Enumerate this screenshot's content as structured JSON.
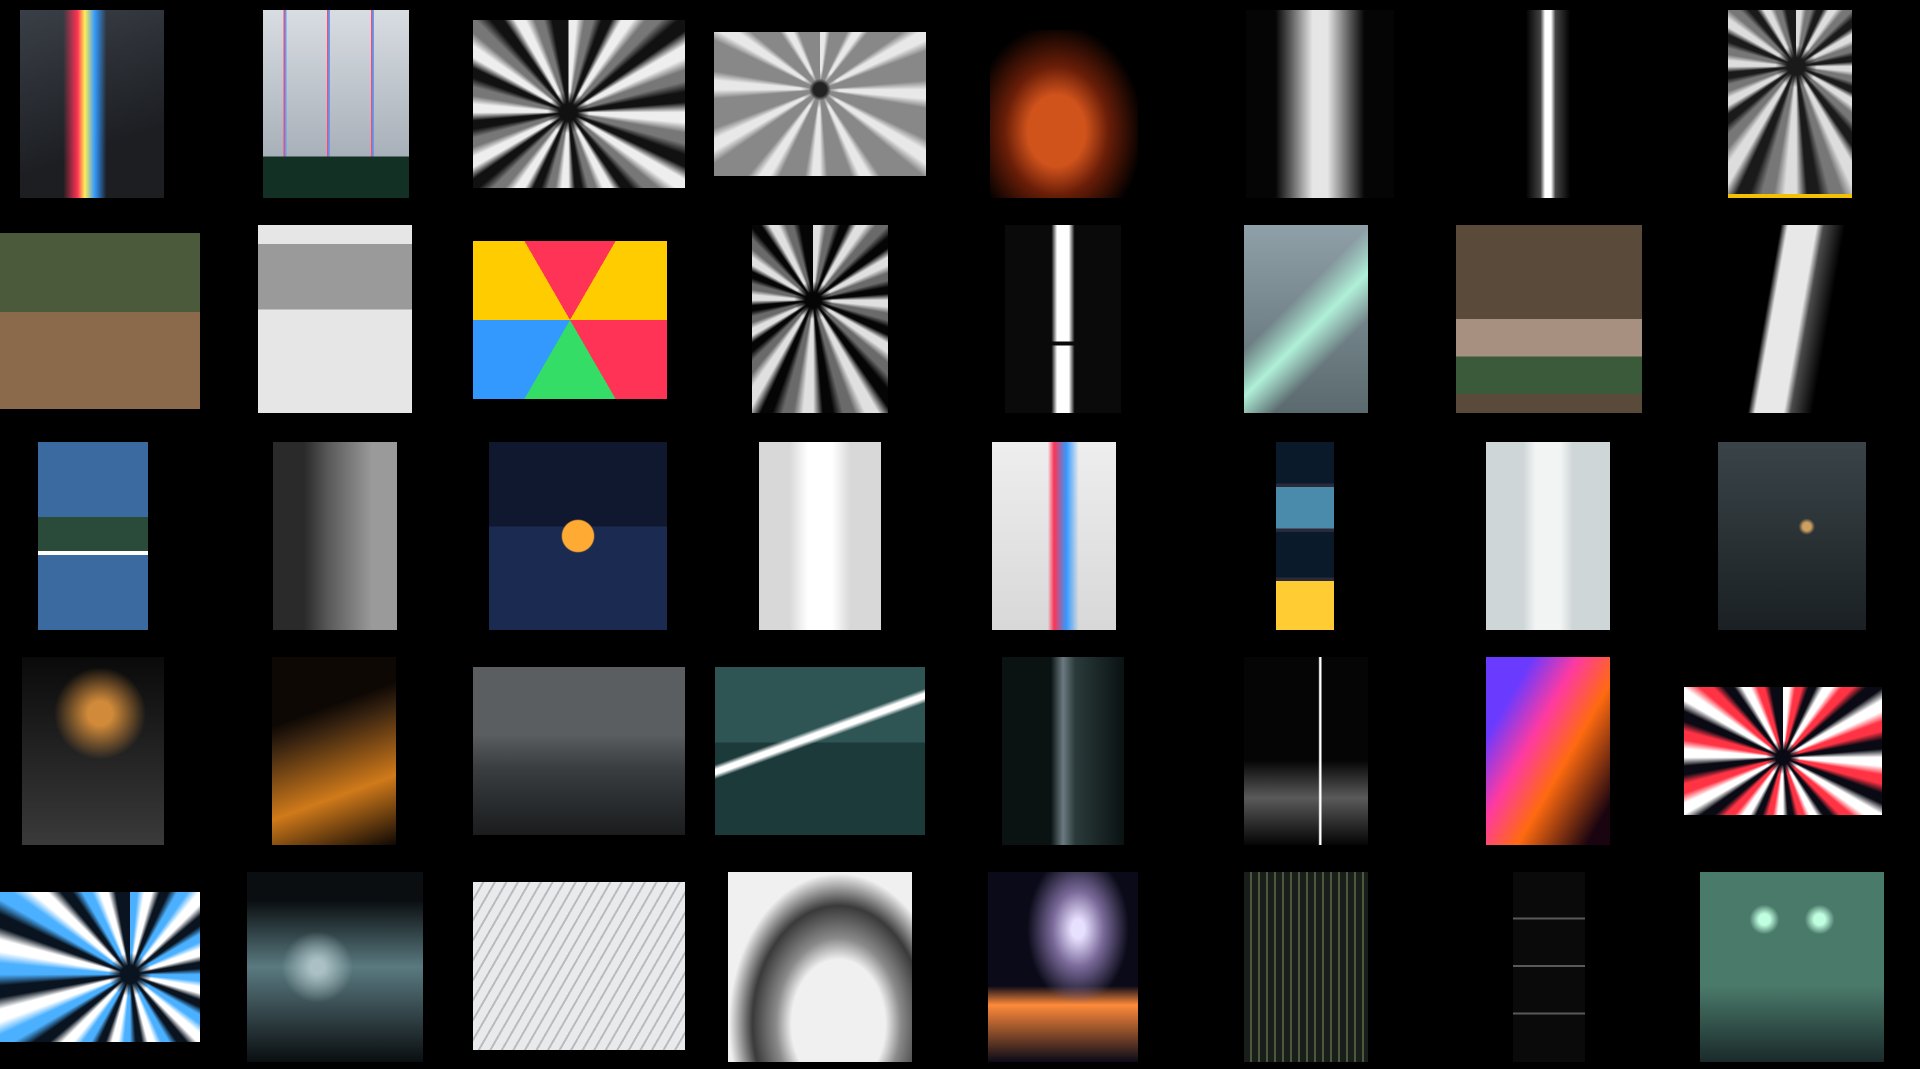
{
  "board": {
    "background": "#000000",
    "rows": [
      {
        "row": 1,
        "tiles": [
          {
            "id": "r1c1",
            "style": "prism-wall",
            "colors": [
              "#1c1e22",
              "#3a3f47",
              "#ff3355",
              "#3399ff",
              "#ffee55"
            ]
          },
          {
            "id": "r1c2",
            "style": "rainbow-room",
            "colors": [
              "#d8dde2",
              "#9aa3ad",
              "#ff4477",
              "#44aaff",
              "#123024"
            ]
          },
          {
            "id": "r1c3",
            "style": "speed-tunnel",
            "colors": [
              "#111111",
              "#eeeeee",
              "#777777",
              "#ff3300",
              "#ffcc00"
            ]
          },
          {
            "id": "r1c4",
            "style": "zoom-corridor",
            "colors": [
              "#222222",
              "#e8e8e8",
              "#888888"
            ]
          },
          {
            "id": "r1c5",
            "style": "orange-glow",
            "colors": [
              "#000000",
              "#d0531c",
              "#6a1e08",
              "#ffffff"
            ]
          },
          {
            "id": "r1c6",
            "style": "light-slit",
            "colors": [
              "#050505",
              "#e6e6e6",
              "#5a5a5a"
            ]
          },
          {
            "id": "r1c7",
            "style": "light-slit-dark",
            "colors": [
              "#000000",
              "#ffffff",
              "#444444"
            ]
          },
          {
            "id": "r1c8",
            "style": "tunnel-yellow",
            "colors": [
              "#1a1a1a",
              "#dddddd",
              "#f2c200"
            ]
          }
        ]
      },
      {
        "row": 2,
        "tiles": [
          {
            "id": "r2c1",
            "style": "inverted-bedroom",
            "colors": [
              "#4a5a3a",
              "#8a6a4a",
              "#2a5a9a",
              "#c45a2a"
            ]
          },
          {
            "id": "r2c2",
            "style": "gallery-window",
            "colors": [
              "#e6e6e6",
              "#9a9a9a",
              "#3a3a3a"
            ]
          },
          {
            "id": "r2c3",
            "style": "hex-cube",
            "colors": [
              "#2a0800",
              "#ffcc00",
              "#ff3355",
              "#33dd66",
              "#3399ff"
            ]
          },
          {
            "id": "r2c4",
            "style": "bw-spiral",
            "colors": [
              "#050505",
              "#e0e0e0",
              "#6a6a6a"
            ]
          },
          {
            "id": "r2c5",
            "style": "split-prism",
            "colors": [
              "#0a0a0a",
              "#ffffff",
              "#888888"
            ]
          },
          {
            "id": "r2c6",
            "style": "fog-building",
            "colors": [
              "#8fa0a8",
              "#5a6a6e",
              "#b0f0d8"
            ]
          },
          {
            "id": "r2c7",
            "style": "inverted-living",
            "colors": [
              "#5a4a3a",
              "#a89080",
              "#3a5a3a",
              "#ffffff"
            ]
          },
          {
            "id": "r2c8",
            "style": "skyscraper-void",
            "colors": [
              "#000000",
              "#e8e8e8",
              "#4a4a4a"
            ]
          }
        ]
      },
      {
        "row": 3,
        "tiles": [
          {
            "id": "r3c1",
            "style": "triple-motion",
            "colors": [
              "#3a6aa0",
              "#d8b060",
              "#2a4a3a",
              "#ffffff"
            ]
          },
          {
            "id": "r3c2",
            "style": "fog-cliff",
            "colors": [
              "#2a2a2a",
              "#9a9a9a",
              "#5a5a5a"
            ]
          },
          {
            "id": "r3c3",
            "style": "harbour-sunset",
            "colors": [
              "#101830",
              "#ffaa33",
              "#ff3322",
              "#1a2a50"
            ]
          },
          {
            "id": "r3c4",
            "style": "rainbow-beam",
            "colors": [
              "#d8d8d8",
              "#ffffff",
              "#ff3355",
              "#33dd66",
              "#3399ff"
            ]
          },
          {
            "id": "r3c5",
            "style": "shadow-spectrum",
            "colors": [
              "#eeeeee",
              "#d8d8d8",
              "#ff3355",
              "#3399ff",
              "#2a1a20"
            ]
          },
          {
            "id": "r3c6",
            "style": "four-panel-night",
            "colors": [
              "#0a1a2a",
              "#4a8aaa",
              "#ffcc33",
              "#2a2a3a"
            ]
          },
          {
            "id": "r3c7",
            "style": "pale-beam",
            "colors": [
              "#cfd6d8",
              "#f2f4f4",
              "#8aa0a8"
            ]
          },
          {
            "id": "r3c8",
            "style": "fog-house",
            "colors": [
              "#1a2024",
              "#3a4448",
              "#d0a060"
            ]
          }
        ]
      },
      {
        "row": 4,
        "tiles": [
          {
            "id": "r4c1",
            "style": "rainy-street",
            "colors": [
              "#0a0a0a",
              "#d08a3a",
              "#3a3a3a"
            ]
          },
          {
            "id": "r4c2",
            "style": "overpass-amber",
            "colors": [
              "#0e0804",
              "#d07a1a",
              "#3a2410"
            ]
          },
          {
            "id": "r4c3",
            "style": "misty-plain",
            "colors": [
              "#3a3e40",
              "#1a1c1e",
              "#5a5e60"
            ]
          },
          {
            "id": "r4c4",
            "style": "teal-room",
            "colors": [
              "#1c3a3a",
              "#2e5454",
              "#ffffff",
              "#c8d8c8"
            ]
          },
          {
            "id": "r4c5",
            "style": "tower-mist",
            "colors": [
              "#0a1212",
              "#2a3a3a",
              "#6a7a80"
            ]
          },
          {
            "id": "r4c6",
            "style": "floor-rays",
            "colors": [
              "#050505",
              "#ffffff",
              "#5a5a5a"
            ]
          },
          {
            "id": "r4c7",
            "style": "neon-bridge",
            "colors": [
              "#1a0410",
              "#ff6a10",
              "#ff3aa0",
              "#6a3aff"
            ]
          },
          {
            "id": "r4c8",
            "style": "color-speed",
            "colors": [
              "#0a0a14",
              "#ffffff",
              "#ff3344",
              "#3399ff"
            ]
          }
        ]
      },
      {
        "row": 5,
        "tiles": [
          {
            "id": "r5c1",
            "style": "blue-warp",
            "colors": [
              "#0a1420",
              "#4ab0ff",
              "#ffffff",
              "#ff9944"
            ]
          },
          {
            "id": "r5c2",
            "style": "night-underpass",
            "colors": [
              "#0a0e10",
              "#5a7a80",
              "#aac0c4"
            ]
          },
          {
            "id": "r5c3",
            "style": "snow-rays",
            "colors": [
              "#e8eaec",
              "#b8bcc0",
              "#202020"
            ]
          },
          {
            "id": "r5c4",
            "style": "white-curve",
            "colors": [
              "#f0f0f0",
              "#3a3a3a",
              "#8a8a8a"
            ]
          },
          {
            "id": "r5c5",
            "style": "galaxy-bridge",
            "colors": [
              "#0a0a18",
              "#7a6a9a",
              "#ff8a3a",
              "#e8e0ff"
            ]
          },
          {
            "id": "r5c6",
            "style": "forest-glow",
            "colors": [
              "#1a1e1a",
              "#4a5a3a",
              "#c0d8a0"
            ]
          },
          {
            "id": "r5c7",
            "style": "four-beams",
            "colors": [
              "#0a0a0a",
              "#ffffff",
              "#5a5a5a"
            ]
          },
          {
            "id": "r5c8",
            "style": "bus-stop-fog",
            "colors": [
              "#1a2a2a",
              "#4a7a6a",
              "#c0ffe0",
              "#ff9a3a"
            ]
          }
        ]
      }
    ]
  }
}
